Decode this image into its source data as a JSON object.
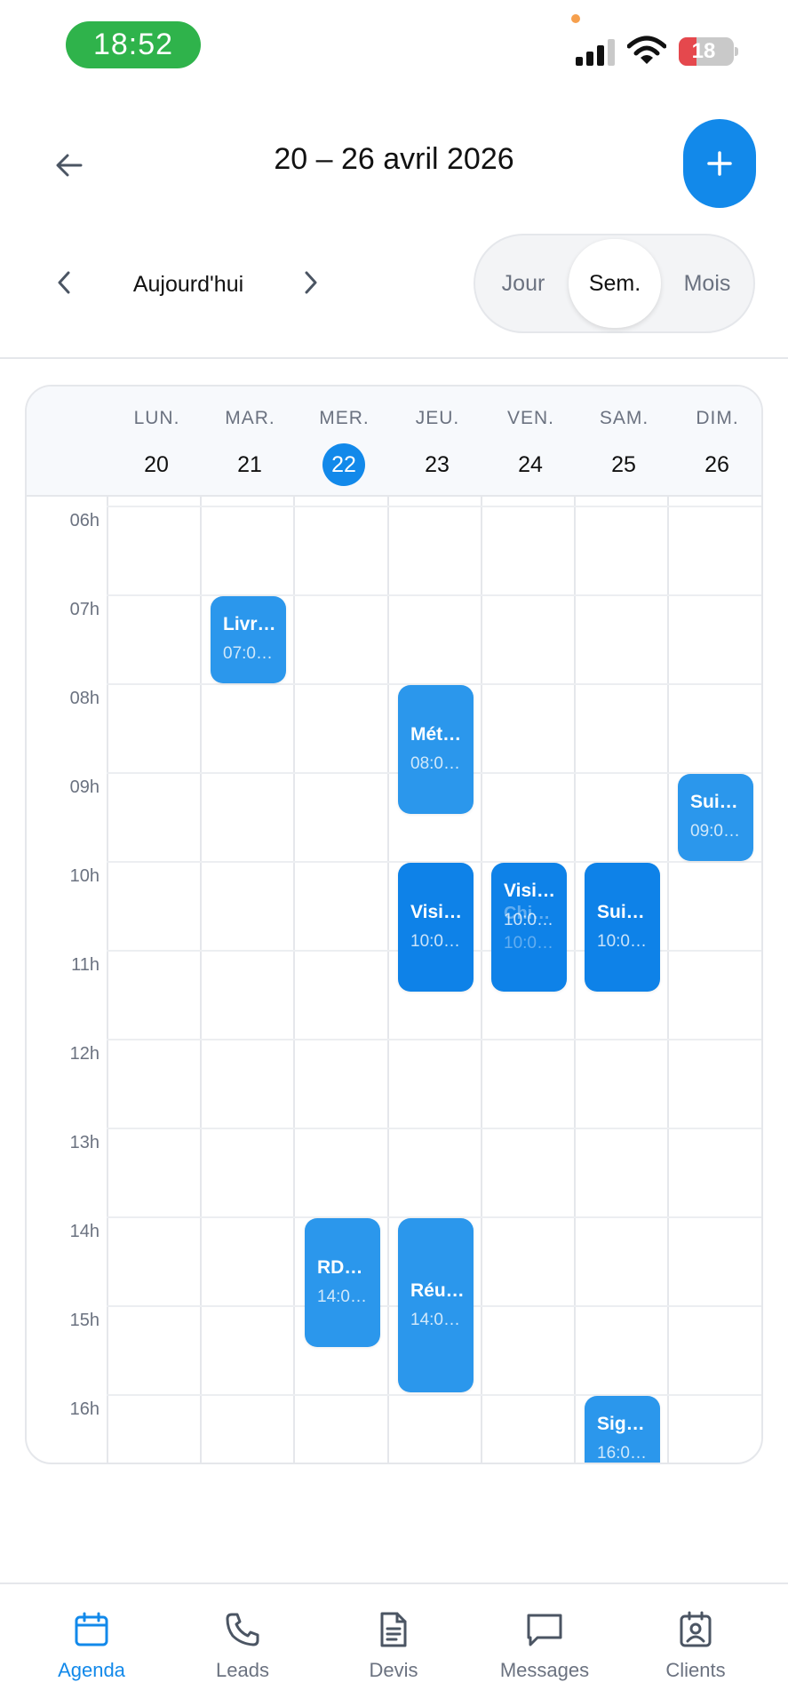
{
  "status_bar": {
    "time": "18:52",
    "battery": "18"
  },
  "header": {
    "title": "20 – 26 avril 2026"
  },
  "nav": {
    "today_label": "Aujourd'hui"
  },
  "view_toggle": {
    "options": [
      "Jour",
      "Sem.",
      "Mois"
    ],
    "active": "Sem."
  },
  "calendar": {
    "days": [
      {
        "name": "LUN.",
        "num": "20"
      },
      {
        "name": "MAR.",
        "num": "21"
      },
      {
        "name": "MER.",
        "num": "22",
        "today": true
      },
      {
        "name": "JEU.",
        "num": "23"
      },
      {
        "name": "VEN.",
        "num": "24"
      },
      {
        "name": "SAM.",
        "num": "25"
      },
      {
        "name": "DIM.",
        "num": "26"
      }
    ],
    "hours": [
      "06h",
      "07h",
      "08h",
      "09h",
      "10h",
      "11h",
      "12h",
      "13h",
      "14h",
      "15h",
      "16h"
    ],
    "events": [
      {
        "title": "Livr…",
        "time": "07:0…"
      },
      {
        "title": "Mét…",
        "time": "08:0…"
      },
      {
        "title": "Sui…",
        "time": "09:0…"
      },
      {
        "title": "Visi…",
        "time": "10:0…"
      },
      {
        "title": "Visi…",
        "time": "10:0…"
      },
      {
        "title": "Sui…",
        "time": "10:0…"
      },
      {
        "title": "RD…",
        "time": "14:0…"
      },
      {
        "title": "Réu…",
        "time": "14:0…"
      },
      {
        "title": "Sig…",
        "time": "16:0…"
      }
    ],
    "overlap_ghost": {
      "title": "Chi…",
      "time": "10:0…"
    }
  },
  "tabs": [
    {
      "label": "Agenda",
      "icon": "calendar-icon",
      "active": true
    },
    {
      "label": "Leads",
      "icon": "phone-icon"
    },
    {
      "label": "Devis",
      "icon": "document-icon"
    },
    {
      "label": "Messages",
      "icon": "message-icon"
    },
    {
      "label": "Clients",
      "icon": "contact-icon"
    }
  ],
  "colors": {
    "accent": "#1289ea",
    "event_light": "#2b97ec",
    "event_dark": "#0e82e8",
    "time_pill": "#2fb34b"
  }
}
